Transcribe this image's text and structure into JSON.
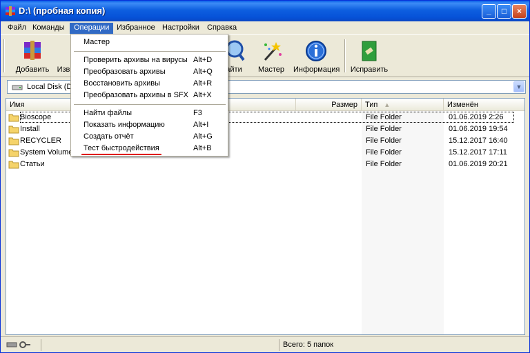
{
  "window": {
    "title": "D:\\ (пробная копия)",
    "min": "_",
    "max": "□",
    "close": "×"
  },
  "menubar": [
    "Файл",
    "Команды",
    "Операции",
    "Избранное",
    "Настройки",
    "Справка"
  ],
  "toolbar": {
    "add": "Добавить",
    "extract_partial": "Изв",
    "find_partial": "айти",
    "wizard": "Мастер",
    "info": "Информация",
    "repair": "Исправить"
  },
  "address": {
    "value": "Local Disk (D"
  },
  "columns": {
    "name": "Имя",
    "size": "Размер",
    "type": "Тип",
    "modified": "Изменён"
  },
  "files": [
    {
      "name": "Bioscope",
      "type": "File Folder",
      "modified": "01.06.2019 2:26"
    },
    {
      "name": "Install",
      "type": "File Folder",
      "modified": "01.06.2019 19:54"
    },
    {
      "name": "RECYCLER",
      "type": "File Folder",
      "modified": "15.12.2017 16:40"
    },
    {
      "name": "System Volume",
      "type": "File Folder",
      "modified": "15.12.2017 17:11"
    },
    {
      "name": "Статьи",
      "type": "File Folder",
      "modified": "01.06.2019 20:21"
    }
  ],
  "status": {
    "total": "Всего: 5 папок"
  },
  "dropdown": {
    "items": [
      {
        "label": "Мастер",
        "key": ""
      },
      {
        "label": "Проверить архивы на вирусы",
        "key": "Alt+D"
      },
      {
        "label": "Преобразовать архивы",
        "key": "Alt+Q"
      },
      {
        "label": "Восстановить архивы",
        "key": "Alt+R"
      },
      {
        "label": "Преобразовать архивы в SFX",
        "key": "Alt+X"
      },
      {
        "label": "Найти файлы",
        "key": "F3"
      },
      {
        "label": "Показать информацию",
        "key": "Alt+I"
      },
      {
        "label": "Создать отчёт",
        "key": "Alt+G"
      },
      {
        "label": "Тест быстродействия",
        "key": "Alt+B"
      }
    ]
  },
  "colors": {
    "title_bar": "#0652d8",
    "menu_highlight": "#316ac5",
    "annotation_underline": "#e00000"
  }
}
